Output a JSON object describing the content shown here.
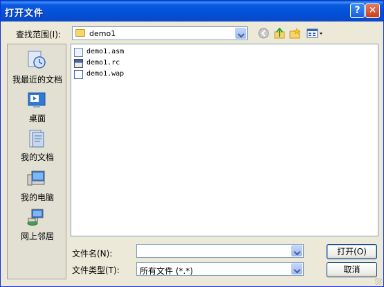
{
  "window": {
    "title": "打开文件",
    "help_label": "?",
    "close_label": "✕"
  },
  "lookin": {
    "label": "查找范围(I):",
    "value": "demo1"
  },
  "toolbar": {
    "back": "back-icon",
    "up": "up-folder-icon",
    "new_folder": "new-folder-icon",
    "view": "view-menu-icon"
  },
  "places": [
    {
      "label": "我最近的文档",
      "icon": "recent-documents-icon"
    },
    {
      "label": "桌面",
      "icon": "desktop-icon"
    },
    {
      "label": "我的文档",
      "icon": "my-documents-icon"
    },
    {
      "label": "我的电脑",
      "icon": "my-computer-icon"
    },
    {
      "label": "网上邻居",
      "icon": "network-places-icon"
    }
  ],
  "files": [
    {
      "name": "demo1.asm",
      "icon": "asm-file-icon"
    },
    {
      "name": "demo1.rc",
      "icon": "rc-file-icon"
    },
    {
      "name": "demo1.wap",
      "icon": "wap-file-icon"
    }
  ],
  "filename": {
    "label": "文件名(N):",
    "value": ""
  },
  "filetype": {
    "label": "文件类型(T):",
    "value": "所有文件 (*.*)"
  },
  "buttons": {
    "open": "打开(O)",
    "cancel": "取消"
  },
  "colors": {
    "title_blue": "#0a5ae0",
    "dialog_bg": "#ece9d8",
    "close_red": "#c7401f"
  }
}
